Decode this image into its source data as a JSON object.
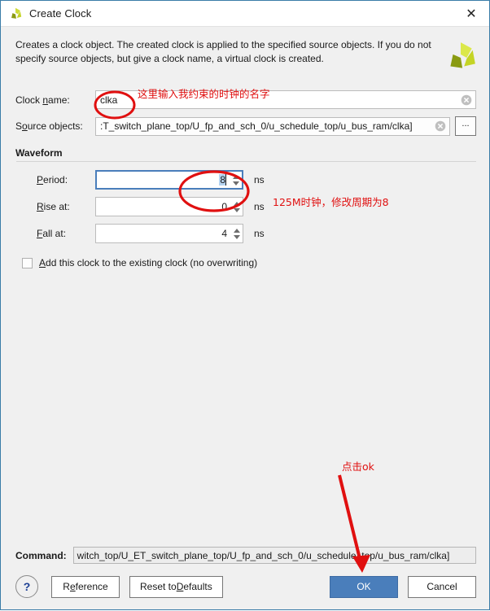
{
  "window": {
    "title": "Create Clock",
    "icon": "vivado-logo-icon",
    "close_label": "✕"
  },
  "banner": {
    "description": "Creates a clock object. The created clock is applied to the specified source objects. If you do not specify source objects, but give a clock name, a virtual clock is created.",
    "logo": "vivado-logo-icon"
  },
  "form": {
    "clock_name": {
      "label_pre": "Clock ",
      "label_underlined": "n",
      "label_post": "ame:",
      "value": "clka",
      "placeholder": ""
    },
    "source_objects": {
      "label_pre": "S",
      "label_underlined": "o",
      "label_post": "urce objects:",
      "value": ":T_switch_plane_top/U_fp_and_sch_0/u_schedule_top/u_bus_ram/clka]",
      "placeholder": "",
      "browse_label": "..."
    }
  },
  "waveform": {
    "title": "Waveform",
    "fields": [
      {
        "label_pre": "",
        "label_underlined": "P",
        "label_post": "eriod:",
        "value": "8",
        "unit": "ns",
        "focused": true,
        "selected": true
      },
      {
        "label_pre": "",
        "label_underlined": "R",
        "label_post": "ise at:",
        "value": "0",
        "unit": "ns",
        "focused": false,
        "selected": false
      },
      {
        "label_pre": "",
        "label_underlined": "F",
        "label_post": "all at:",
        "value": "4",
        "unit": "ns",
        "focused": false,
        "selected": false
      }
    ],
    "checkbox": {
      "checked": false,
      "label_pre": "",
      "label_underlined": "A",
      "label_post": "dd this clock to the existing clock (no overwriting)"
    }
  },
  "command": {
    "label": "Command:",
    "value": "witch_top/U_ET_switch_plane_top/U_fp_and_sch_0/u_schedule_top/u_bus_ram/clka]"
  },
  "buttons": {
    "help": "?",
    "reference_pre": "R",
    "reference_underlined": "e",
    "reference_post": "ference",
    "reset_pre": "Reset to ",
    "reset_underlined": "D",
    "reset_post": "efaults",
    "ok": "OK",
    "cancel": "Cancel"
  },
  "annotations": {
    "clock_name_note": "这里输入我约束的时钟的名字",
    "period_note": "125M时钟，修改周期为8",
    "ok_note": "点击ok"
  },
  "colors": {
    "accent": "#4a7ebb",
    "annotation": "#e01010",
    "border": "#3a7ca8",
    "dialog_bg": "#f0f0f0",
    "logo_light": "#cddb38",
    "logo_dark": "#8a9b12"
  }
}
